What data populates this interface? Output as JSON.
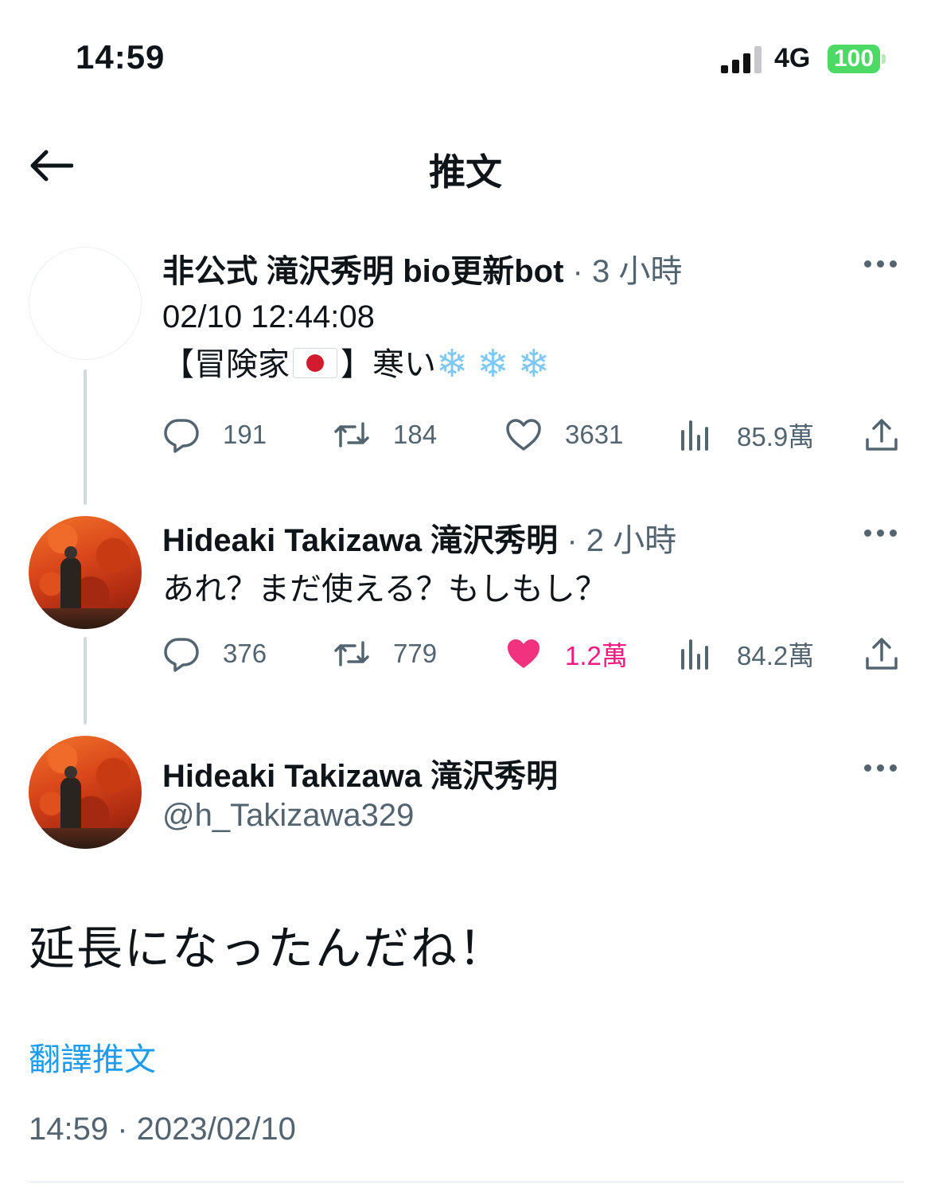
{
  "status_bar": {
    "time": "14:59",
    "network": "4G",
    "battery": "100"
  },
  "header": {
    "title": "推文"
  },
  "thread": [
    {
      "name": "非公式 滝沢秀明 bio更新bot",
      "meta": "· 3 小時",
      "lines": [
        "02/10 12:44:08"
      ],
      "text_prefix": "【冒険家",
      "flag_icon": "japan-flag-icon",
      "text_suffix": "】寒い",
      "snow_icon": "snowflake-icon",
      "snowflake_glyph": "❄",
      "replies": "191",
      "retweets": "184",
      "likes": "3631",
      "views": "85.9萬",
      "liked": false
    },
    {
      "name": "Hideaki Takizawa 滝沢秀明",
      "meta": "· 2 小時",
      "text": "あれ？まだ使える？もしもし？",
      "replies": "376",
      "retweets": "779",
      "likes": "1.2萬",
      "views": "84.2萬",
      "liked": true
    }
  ],
  "main_tweet": {
    "name": "Hideaki Takizawa 滝沢秀明",
    "handle": "@h_Takizawa329",
    "text": "延長になったんだね！",
    "translate": "翻譯推文",
    "timestamp": "14:59 · 2023/02/10"
  },
  "colors": {
    "accent": "#1d9bf0",
    "like": "#f91880",
    "muted": "#536471",
    "battery": "#4cd964"
  }
}
